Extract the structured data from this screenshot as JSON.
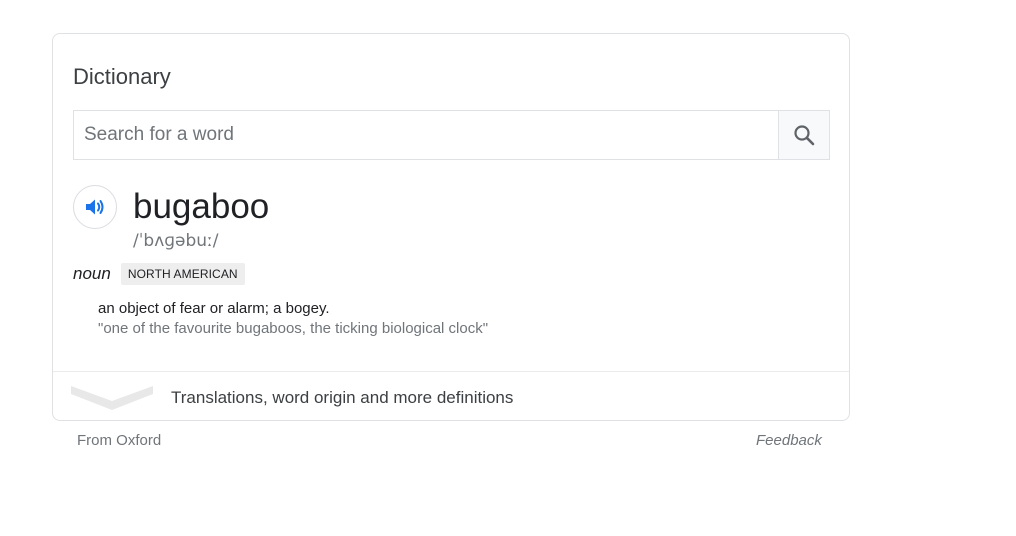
{
  "card": {
    "title": "Dictionary"
  },
  "search": {
    "placeholder": "Search for a word",
    "value": ""
  },
  "entry": {
    "word": "bugaboo",
    "pronunciation": "/ˈbʌɡəbuː/",
    "part_of_speech": "noun",
    "region_badge": "NORTH AMERICAN",
    "definition": "an object of fear or alarm; a bogey.",
    "example": "\"one of the favourite bugaboos, the ticking biological clock\""
  },
  "more": {
    "label": "Translations, word origin and more definitions"
  },
  "footer": {
    "source": "From Oxford",
    "feedback": "Feedback"
  },
  "icons": {
    "search": "search-icon",
    "speaker": "speaker-icon",
    "expand": "chevron-down-icon"
  },
  "colors": {
    "speaker_blue": "#1a73e8",
    "chevron_gray": "#e8e8e8",
    "search_icon": "#5f6368"
  }
}
